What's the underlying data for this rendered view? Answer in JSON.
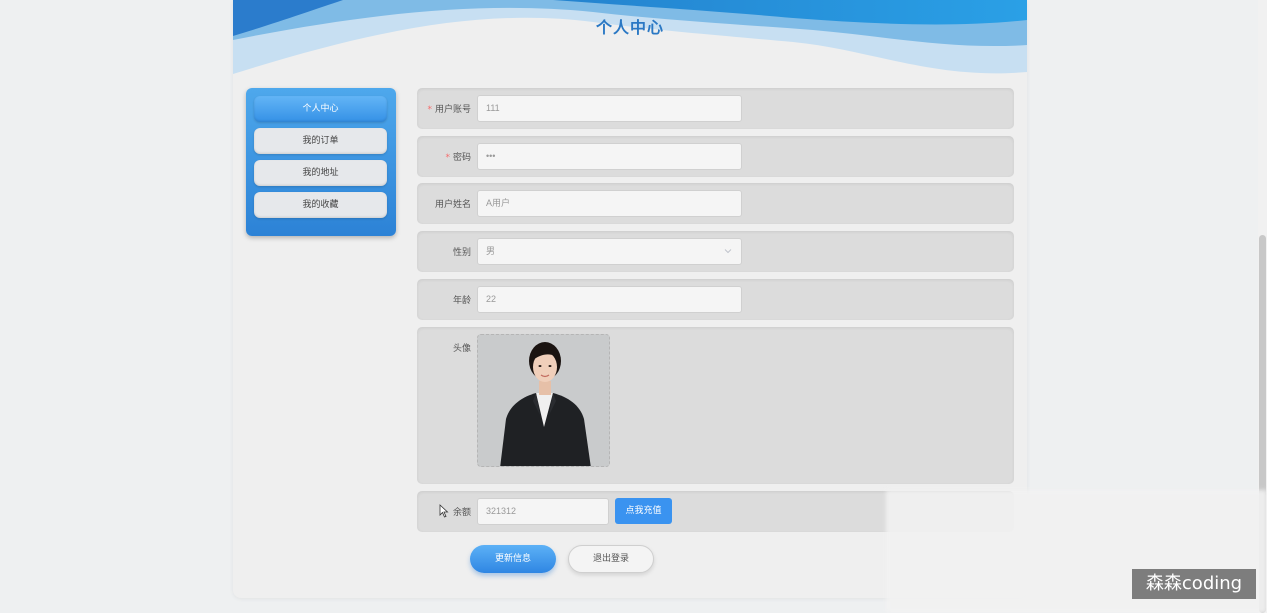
{
  "header": {
    "title": "个人中心"
  },
  "sidebar": {
    "items": [
      {
        "label": "个人中心",
        "active": true
      },
      {
        "label": "我的订单"
      },
      {
        "label": "我的地址"
      },
      {
        "label": "我的收藏"
      }
    ]
  },
  "form": {
    "account": {
      "label": "用户账号",
      "value": "111",
      "required": true
    },
    "password": {
      "label": "密码",
      "value": "•••",
      "required": true
    },
    "name": {
      "label": "用户姓名",
      "value": "A用户"
    },
    "gender": {
      "label": "性别",
      "value": "男"
    },
    "age": {
      "label": "年龄",
      "value": "22"
    },
    "avatar": {
      "label": "头像"
    },
    "balance": {
      "label": "余额",
      "value": "321312",
      "recharge_label": "点我充值"
    }
  },
  "actions": {
    "update_label": "更新信息",
    "logout_label": "退出登录"
  },
  "watermark": "森森coding",
  "colors": {
    "accent": "#3a93f0",
    "title": "#2a78c4",
    "required": "#f56c6c"
  }
}
